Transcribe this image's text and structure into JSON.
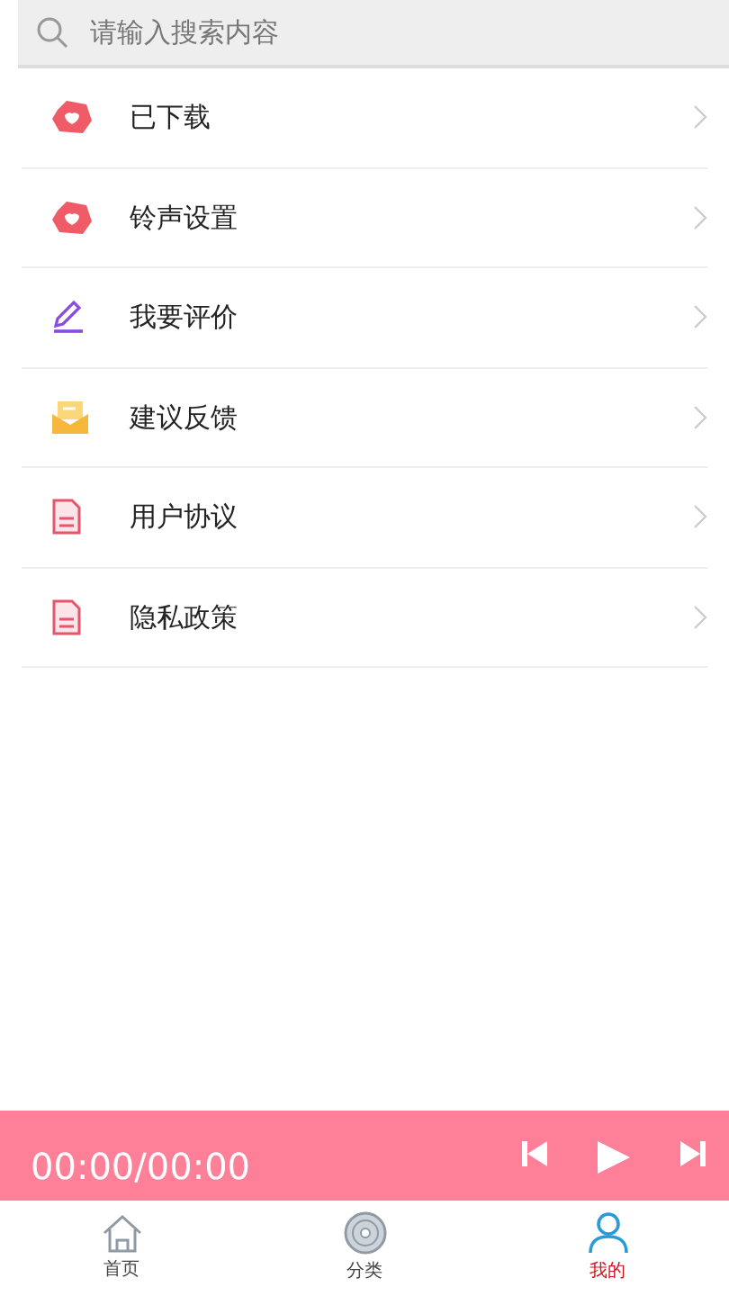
{
  "search": {
    "placeholder": "请输入搜索内容"
  },
  "menu": [
    {
      "label": "已下载",
      "kind": "download"
    },
    {
      "label": "铃声设置",
      "kind": "download"
    },
    {
      "label": "我要评价",
      "kind": "review"
    },
    {
      "label": "建议反馈",
      "kind": "feedback"
    },
    {
      "label": "用户协议",
      "kind": "document"
    },
    {
      "label": "隐私政策",
      "kind": "document"
    }
  ],
  "player": {
    "time": "00:00/00:00"
  },
  "tabs": [
    {
      "label": "首页",
      "kind": "home",
      "selected": false
    },
    {
      "label": "分类",
      "kind": "disc",
      "selected": false
    },
    {
      "label": "我的",
      "kind": "user",
      "selected": true
    }
  ]
}
